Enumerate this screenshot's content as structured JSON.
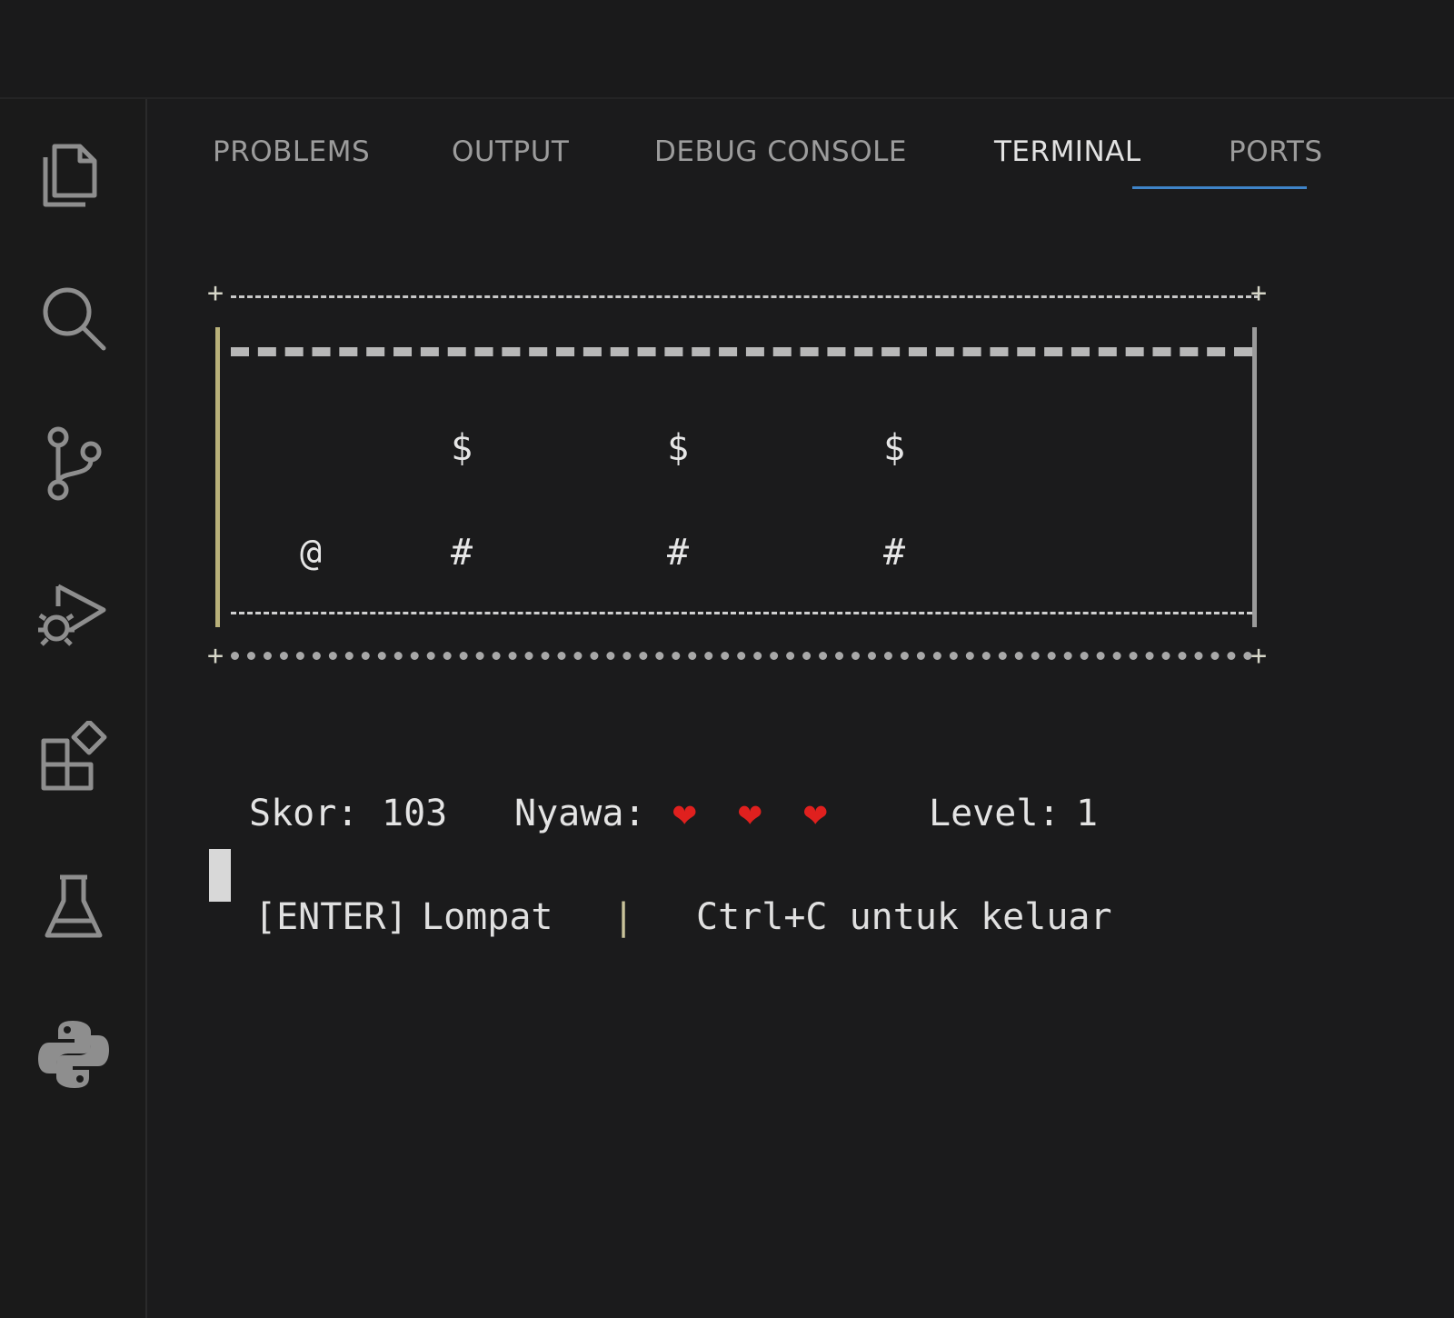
{
  "activity_bar": {
    "items": [
      {
        "name": "explorer",
        "icon": "files-icon"
      },
      {
        "name": "search",
        "icon": "search-icon"
      },
      {
        "name": "source-control",
        "icon": "source-control-icon"
      },
      {
        "name": "run-and-debug",
        "icon": "run-debug-icon"
      },
      {
        "name": "extensions",
        "icon": "extensions-icon"
      },
      {
        "name": "testing",
        "icon": "flask-icon"
      },
      {
        "name": "python",
        "icon": "python-icon"
      }
    ]
  },
  "panel": {
    "tabs": [
      {
        "label": "PROBLEMS",
        "active": false
      },
      {
        "label": "OUTPUT",
        "active": false
      },
      {
        "label": "DEBUG CONSOLE",
        "active": false
      },
      {
        "label": "TERMINAL",
        "active": true
      },
      {
        "label": "PORTS",
        "active": false
      }
    ],
    "accent_color": "#3f84c8"
  },
  "terminal": {
    "game": {
      "corner_char": "+",
      "player": "@",
      "coins": [
        "$",
        "$",
        "$"
      ],
      "obstacles": [
        "#",
        "#",
        "#"
      ]
    },
    "status": {
      "score_label": "Skor:",
      "score_value": "103",
      "lives_label": "Nyawa:",
      "lives": [
        "❤",
        "❤",
        "❤"
      ],
      "level_label": "Level:",
      "level_value": "1"
    },
    "help": {
      "key": "[ENTER]",
      "action": "Lompat",
      "separator": "|",
      "quit_hint": "Ctrl+C untuk keluar"
    }
  }
}
